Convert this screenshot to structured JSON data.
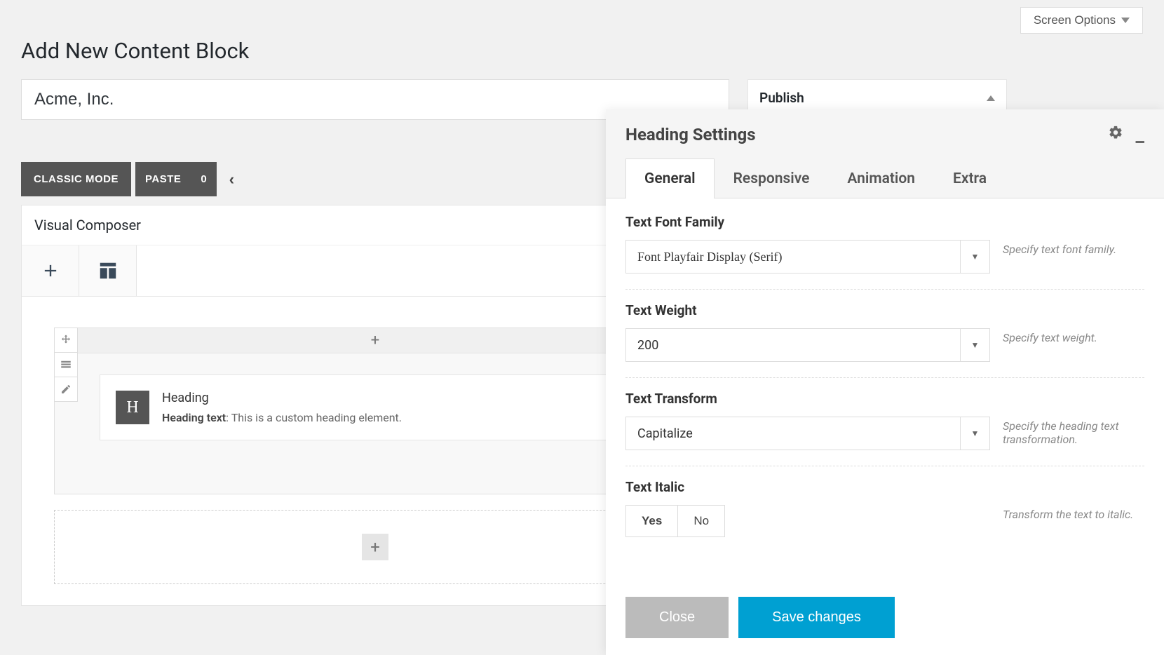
{
  "screenOptions": {
    "label": "Screen Options"
  },
  "page": {
    "title": "Add New Content Block"
  },
  "titleInput": {
    "value": "Acme, Inc."
  },
  "publish": {
    "title": "Publish"
  },
  "modeButtons": {
    "classic": "CLASSIC MODE",
    "paste": "PASTE",
    "count": "0"
  },
  "composer": {
    "title": "Visual Composer",
    "element": {
      "iconLetter": "H",
      "title": "Heading",
      "metaLabel": "Heading text",
      "metaValue": ": This is a custom heading element."
    }
  },
  "settings": {
    "title": "Heading Settings",
    "tabs": {
      "general": "General",
      "responsive": "Responsive",
      "animation": "Animation",
      "extra": "Extra"
    },
    "fields": {
      "fontFamily": {
        "label": "Text Font Family",
        "value": "Font Playfair Display (Serif)",
        "hint": "Specify text font family."
      },
      "textWeight": {
        "label": "Text Weight",
        "value": "200",
        "hint": "Specify text weight."
      },
      "textTransform": {
        "label": "Text Transform",
        "value": "Capitalize",
        "hint": "Specify the heading text transformation."
      },
      "textItalic": {
        "label": "Text Italic",
        "yes": "Yes",
        "no": "No",
        "hint": "Transform the text to italic."
      }
    },
    "footer": {
      "close": "Close",
      "save": "Save changes"
    }
  }
}
